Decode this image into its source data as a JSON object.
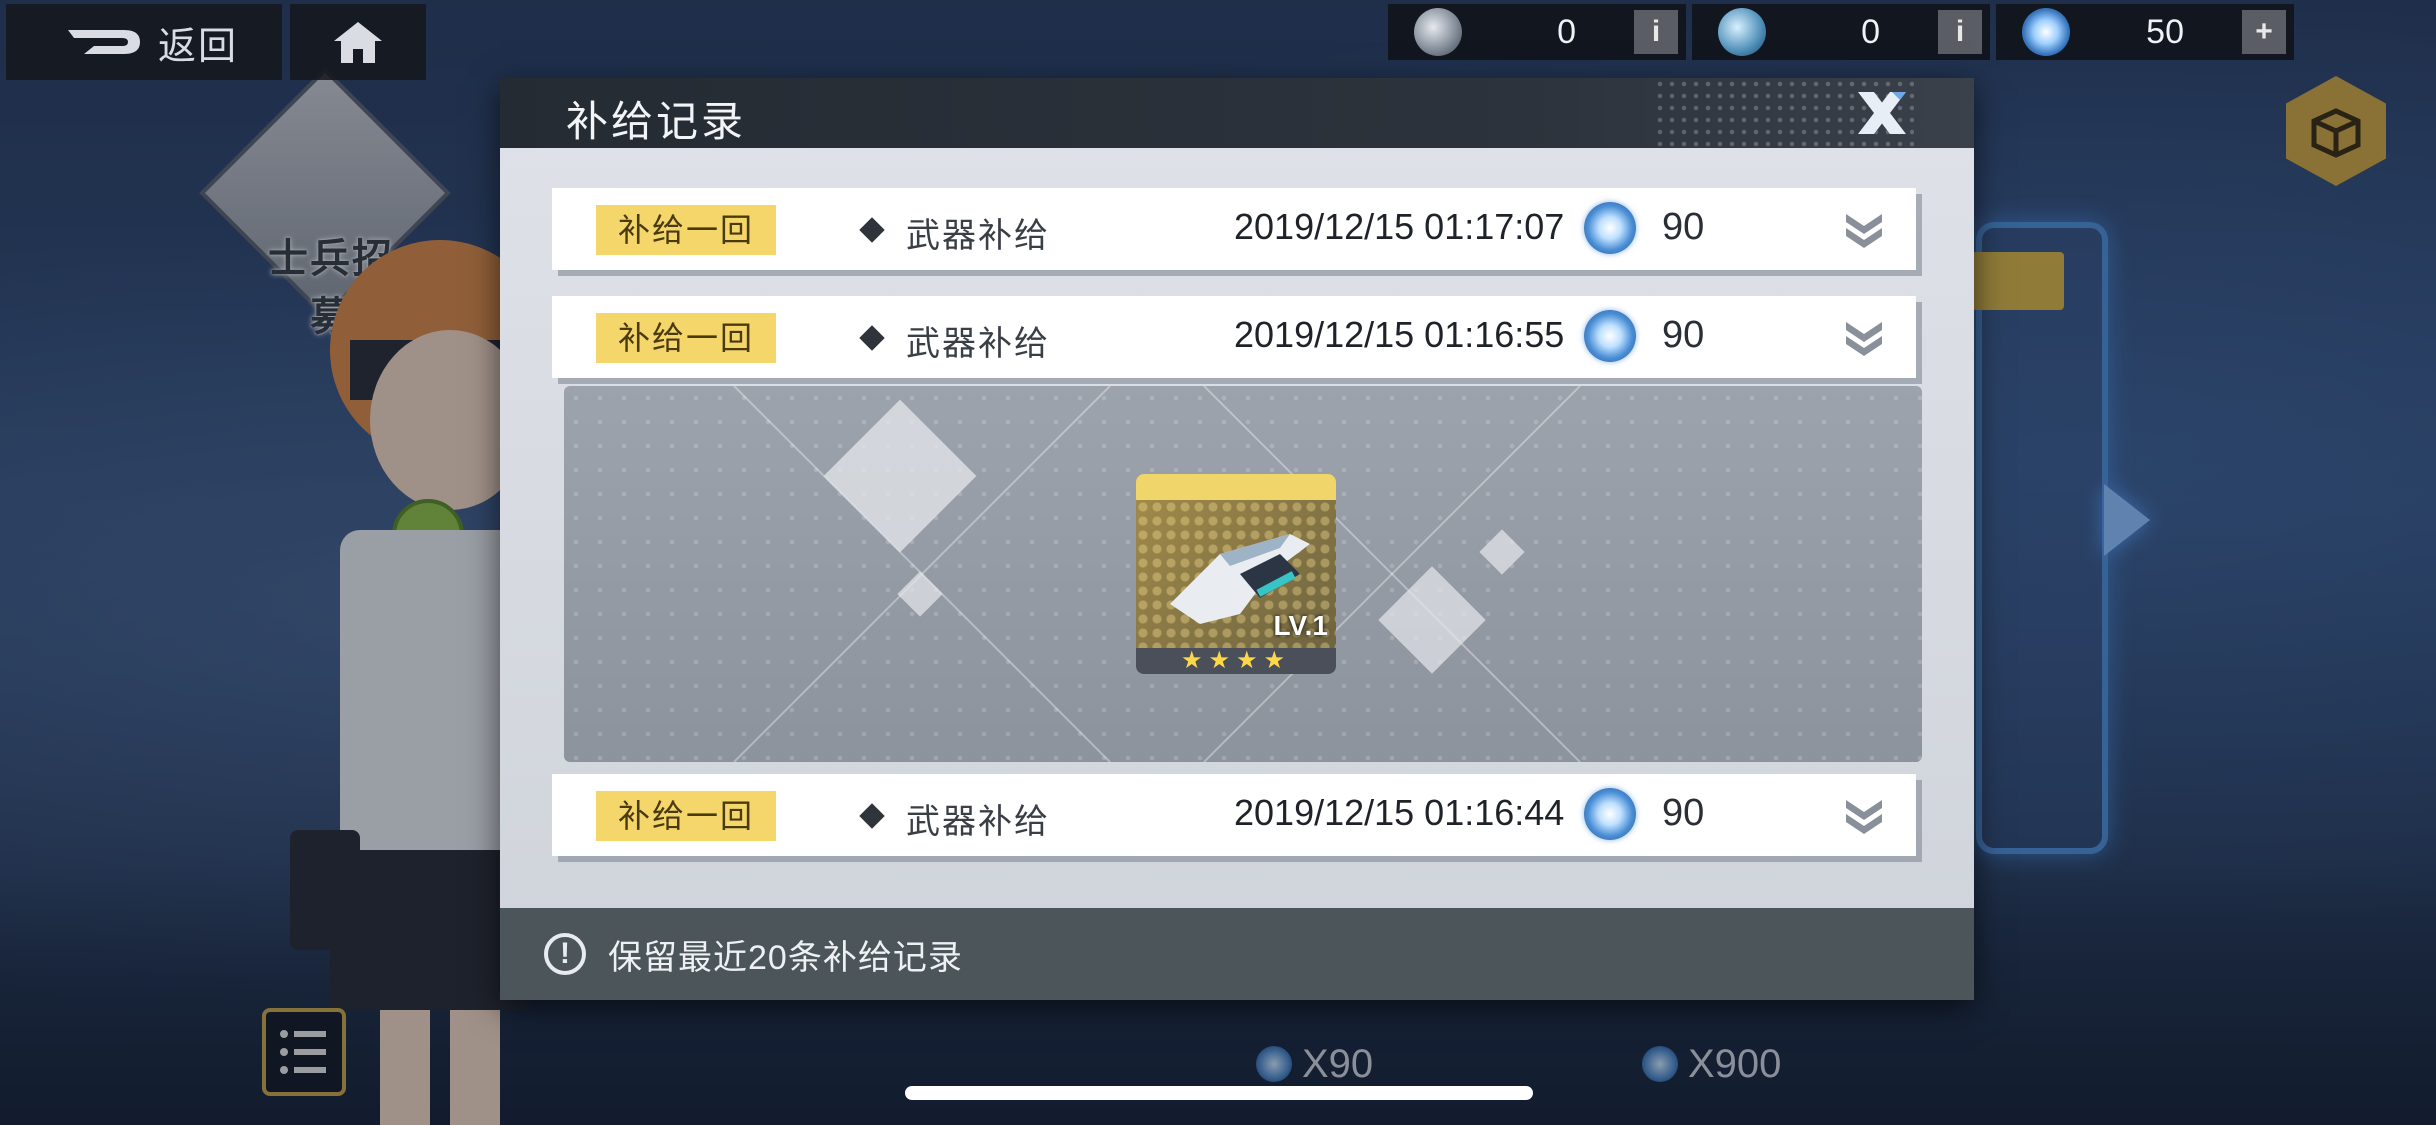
{
  "nav": {
    "back_label": "返回"
  },
  "currencies": [
    {
      "icon": "silver-coin-icon",
      "amount": "0",
      "action": "i"
    },
    {
      "icon": "blue-coin-icon",
      "amount": "0",
      "action": "i"
    },
    {
      "icon": "crystal-gem-icon",
      "amount": "50",
      "action": "+"
    }
  ],
  "side": {
    "recruit_label": "士兵招募"
  },
  "modal": {
    "title": "补给记录",
    "records": [
      {
        "badge": "补给一回",
        "type": "武器补给",
        "time": "2019/12/15 01:17:07",
        "cost": "90"
      },
      {
        "badge": "补给一回",
        "type": "武器补给",
        "time": "2019/12/15 01:16:55",
        "cost": "90"
      },
      {
        "badge": "补给一回",
        "type": "武器补给",
        "time": "2019/12/15 01:16:44",
        "cost": "90"
      }
    ],
    "detail_item": {
      "level": "LV.1",
      "stars": "★★★★",
      "star_count": 4,
      "icon": "weapon-gun-icon"
    },
    "footer_note": "保留最近20条补给记录"
  },
  "bottom": {
    "cost_single": "X90",
    "cost_ten": "X900"
  },
  "colors": {
    "badge": "#f5d66a",
    "header": "#252b33",
    "footer": "#4c555a",
    "accent_gold": "#cfa644"
  }
}
